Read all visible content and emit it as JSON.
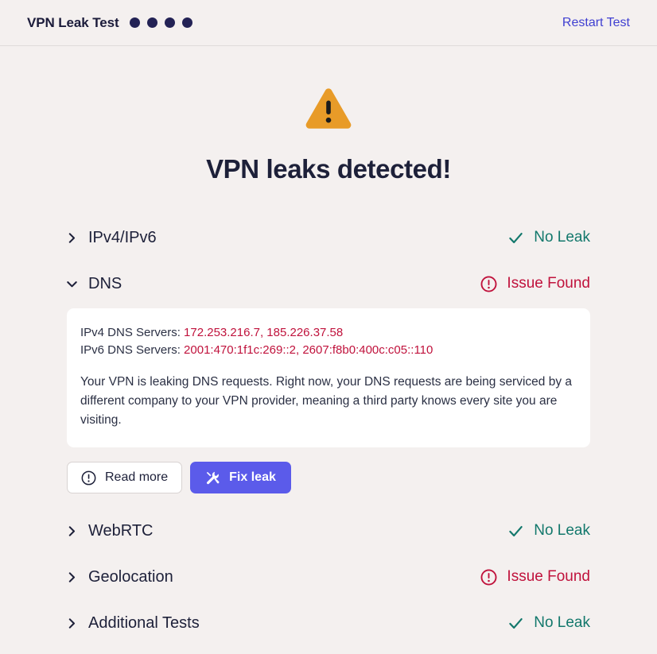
{
  "header": {
    "brand_title": "VPN Leak Test",
    "dots_count": 4,
    "dot_color": "#232255",
    "restart_label": "Restart Test",
    "restart_color": "#3f3fd1"
  },
  "hero": {
    "icon": "warning-triangle-icon",
    "icon_color": "#e89b28",
    "title": "VPN leaks detected!"
  },
  "results": [
    {
      "id": "ipv4-ipv6",
      "label": "IPv4/IPv6",
      "expanded": false,
      "chevron": "chevron-right-icon",
      "status_label": "No Leak",
      "status_type": "ok",
      "status_icon": "check-icon",
      "status_color": "#13786c"
    },
    {
      "id": "dns",
      "label": "DNS",
      "expanded": true,
      "chevron": "chevron-down-icon",
      "status_label": "Issue Found",
      "status_type": "bad",
      "status_icon": "exclamation-circle-icon",
      "status_color": "#c0123c"
    },
    {
      "id": "webrtc",
      "label": "WebRTC",
      "expanded": false,
      "chevron": "chevron-right-icon",
      "status_label": "No Leak",
      "status_type": "ok",
      "status_icon": "check-icon",
      "status_color": "#13786c"
    },
    {
      "id": "geolocation",
      "label": "Geolocation",
      "expanded": false,
      "chevron": "chevron-right-icon",
      "status_label": "Issue Found",
      "status_type": "bad",
      "status_icon": "exclamation-circle-icon",
      "status_color": "#c0123c"
    },
    {
      "id": "additional-tests",
      "label": "Additional Tests",
      "expanded": false,
      "chevron": "chevron-right-icon",
      "status_label": "No Leak",
      "status_type": "ok",
      "status_icon": "check-icon",
      "status_color": "#13786c"
    }
  ],
  "dns_detail": {
    "ipv4_label": "IPv4 DNS Servers:",
    "ipv4_servers": "172.253.216.7, 185.226.37.58",
    "ipv6_label": "IPv6 DNS Servers:",
    "ipv6_servers": "2001:470:1f1c:269::2, 2607:f8b0:400c:c05::110",
    "description": "Your VPN is leaking DNS requests. Right now, your DNS requests are being serviced by a different company to your VPN provider, meaning a third party knows every site you are visiting.",
    "buttons": {
      "read_more_label": "Read more",
      "read_more_icon": "exclamation-circle-icon",
      "fix_leak_label": "Fix leak",
      "fix_leak_icon": "tools-icon",
      "fix_leak_color": "#5b5bea"
    }
  }
}
